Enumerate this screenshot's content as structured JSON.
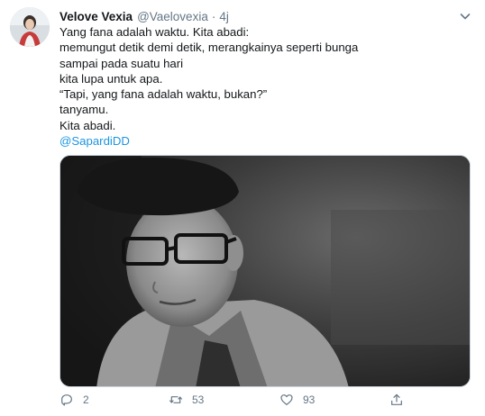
{
  "tweet": {
    "author_name": "Velove Vexia",
    "author_handle": "@Vaelovexia",
    "separator": "·",
    "time_ago": "4j",
    "lines": [
      "Yang fana adalah waktu. Kita abadi:",
      "memungut detik demi detik, merangkainya seperti bunga",
      "sampai pada suatu hari",
      "kita lupa untuk apa.",
      "“Tapi, yang fana adalah waktu, bukan?”",
      "tanyamu.",
      "Kita abadi."
    ],
    "mention": "@SapardiDD"
  },
  "actions": {
    "reply_count": "2",
    "retweet_count": "53",
    "like_count": "93"
  },
  "icons": {
    "reply": "reply-icon",
    "retweet": "retweet-icon",
    "like": "heart-icon",
    "share": "share-icon",
    "more": "chevron-down-icon"
  },
  "colors": {
    "link": "#1b95e0",
    "muted": "#657786",
    "text": "#14171a"
  }
}
